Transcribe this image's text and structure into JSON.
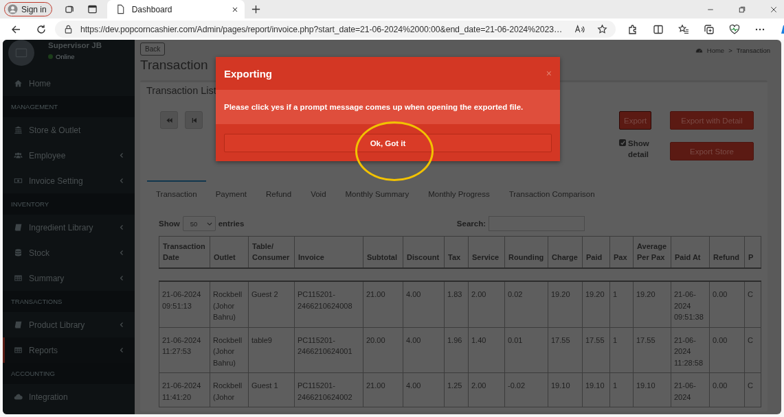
{
  "browser": {
    "sign_in": "Sign in",
    "tab_title": "Dashboard",
    "url": "https://dev.popcorncashier.com/Admin/pages/report/invoice.php?start_date=21-06-2024%2000:00&end_date=21-06-2024%2023…"
  },
  "sidebar": {
    "user": {
      "name": "Supervisor JB",
      "status": "Online"
    },
    "items": [
      {
        "kind": "item",
        "label": "Home",
        "expandable": false,
        "selected": false
      },
      {
        "kind": "header",
        "label": "MANAGEMENT"
      },
      {
        "kind": "item",
        "label": "Store & Outlet",
        "expandable": false,
        "selected": false
      },
      {
        "kind": "item",
        "label": "Employee",
        "expandable": true,
        "selected": false
      },
      {
        "kind": "item",
        "label": "Invoice Setting",
        "expandable": true,
        "selected": false
      },
      {
        "kind": "header",
        "label": "INVENTORY"
      },
      {
        "kind": "item",
        "label": "Ingredient Library",
        "expandable": true,
        "selected": false
      },
      {
        "kind": "item",
        "label": "Stock",
        "expandable": true,
        "selected": false
      },
      {
        "kind": "item",
        "label": "Summary",
        "expandable": true,
        "selected": false
      },
      {
        "kind": "header",
        "label": "TRANSACTIONS"
      },
      {
        "kind": "item",
        "label": "Product Library",
        "expandable": true,
        "selected": false
      },
      {
        "kind": "item",
        "label": "Reports",
        "expandable": true,
        "selected": true
      },
      {
        "kind": "header",
        "label": "ACCOUNTING"
      },
      {
        "kind": "item",
        "label": "Integration",
        "expandable": false,
        "selected": false
      }
    ]
  },
  "page": {
    "back_button": "Back",
    "title": "Transaction",
    "breadcrumb": [
      "Home",
      "Transaction"
    ],
    "breadcrumb_separator": ">",
    "box_title": "Transaction List",
    "export_buttons": [
      "Export",
      "Export with Detail",
      "Export Store"
    ],
    "show_detail": {
      "label": "Show detail",
      "checked": true
    },
    "tabs": [
      {
        "label": "Transaction",
        "selected": true
      },
      {
        "label": "Payment",
        "selected": false
      },
      {
        "label": "Refund",
        "selected": false
      },
      {
        "label": "Void",
        "selected": false
      },
      {
        "label": "Monthly Summary",
        "selected": false
      },
      {
        "label": "Monthly Progress",
        "selected": false
      },
      {
        "label": "Transaction Comparison",
        "selected": false
      }
    ],
    "table": {
      "show_label": "Show",
      "page_size": "50",
      "entries_label": "entries",
      "search_label": "Search:",
      "columns": [
        "Transaction Date",
        "Outlet",
        "Table/ Consumer",
        "Invoice",
        "Subtotal",
        "Discount",
        "Tax",
        "Service",
        "Rounding",
        "Charge",
        "Paid",
        "Pax",
        "Average Per Pax",
        "Paid At",
        "Refund",
        "P"
      ],
      "rows": [
        [
          "21-06-2024 09:51:13",
          "Rockbell (Johor Bahru)",
          "Guest 2",
          "PC115201-2466210624008",
          "21.00",
          "4.00",
          "1.83",
          "2.00",
          "0.02",
          "19.20",
          "19.20",
          "1",
          "19.20",
          "21-06-2024 09:51:38",
          "0.00",
          "C"
        ],
        [
          "21-06-2024 11:27:53",
          "Rockbell (Johor Bahru)",
          "table9",
          "PC115201-2466210624001",
          "20.00",
          "4.00",
          "1.96",
          "1.40",
          "0.01",
          "17.55",
          "17.55",
          "1",
          "17.55",
          "21-06-2024 11:28:58",
          "0.00",
          "C"
        ],
        [
          "21-06-2024 11:41:20",
          "Rockbell (Johor",
          "Guest 1",
          "PC115201-2466210624002",
          "21.00",
          "4.00",
          "1.25",
          "2.00",
          "-0.02",
          "19.10",
          "19.10",
          "1",
          "19.10",
          "21-06-2024",
          "0.00",
          "C"
        ]
      ]
    }
  },
  "modal": {
    "title": "Exporting",
    "close": "×",
    "message": "Please click yes if a prompt message comes up when opening the exported file.",
    "button": "Ok, Got it"
  }
}
